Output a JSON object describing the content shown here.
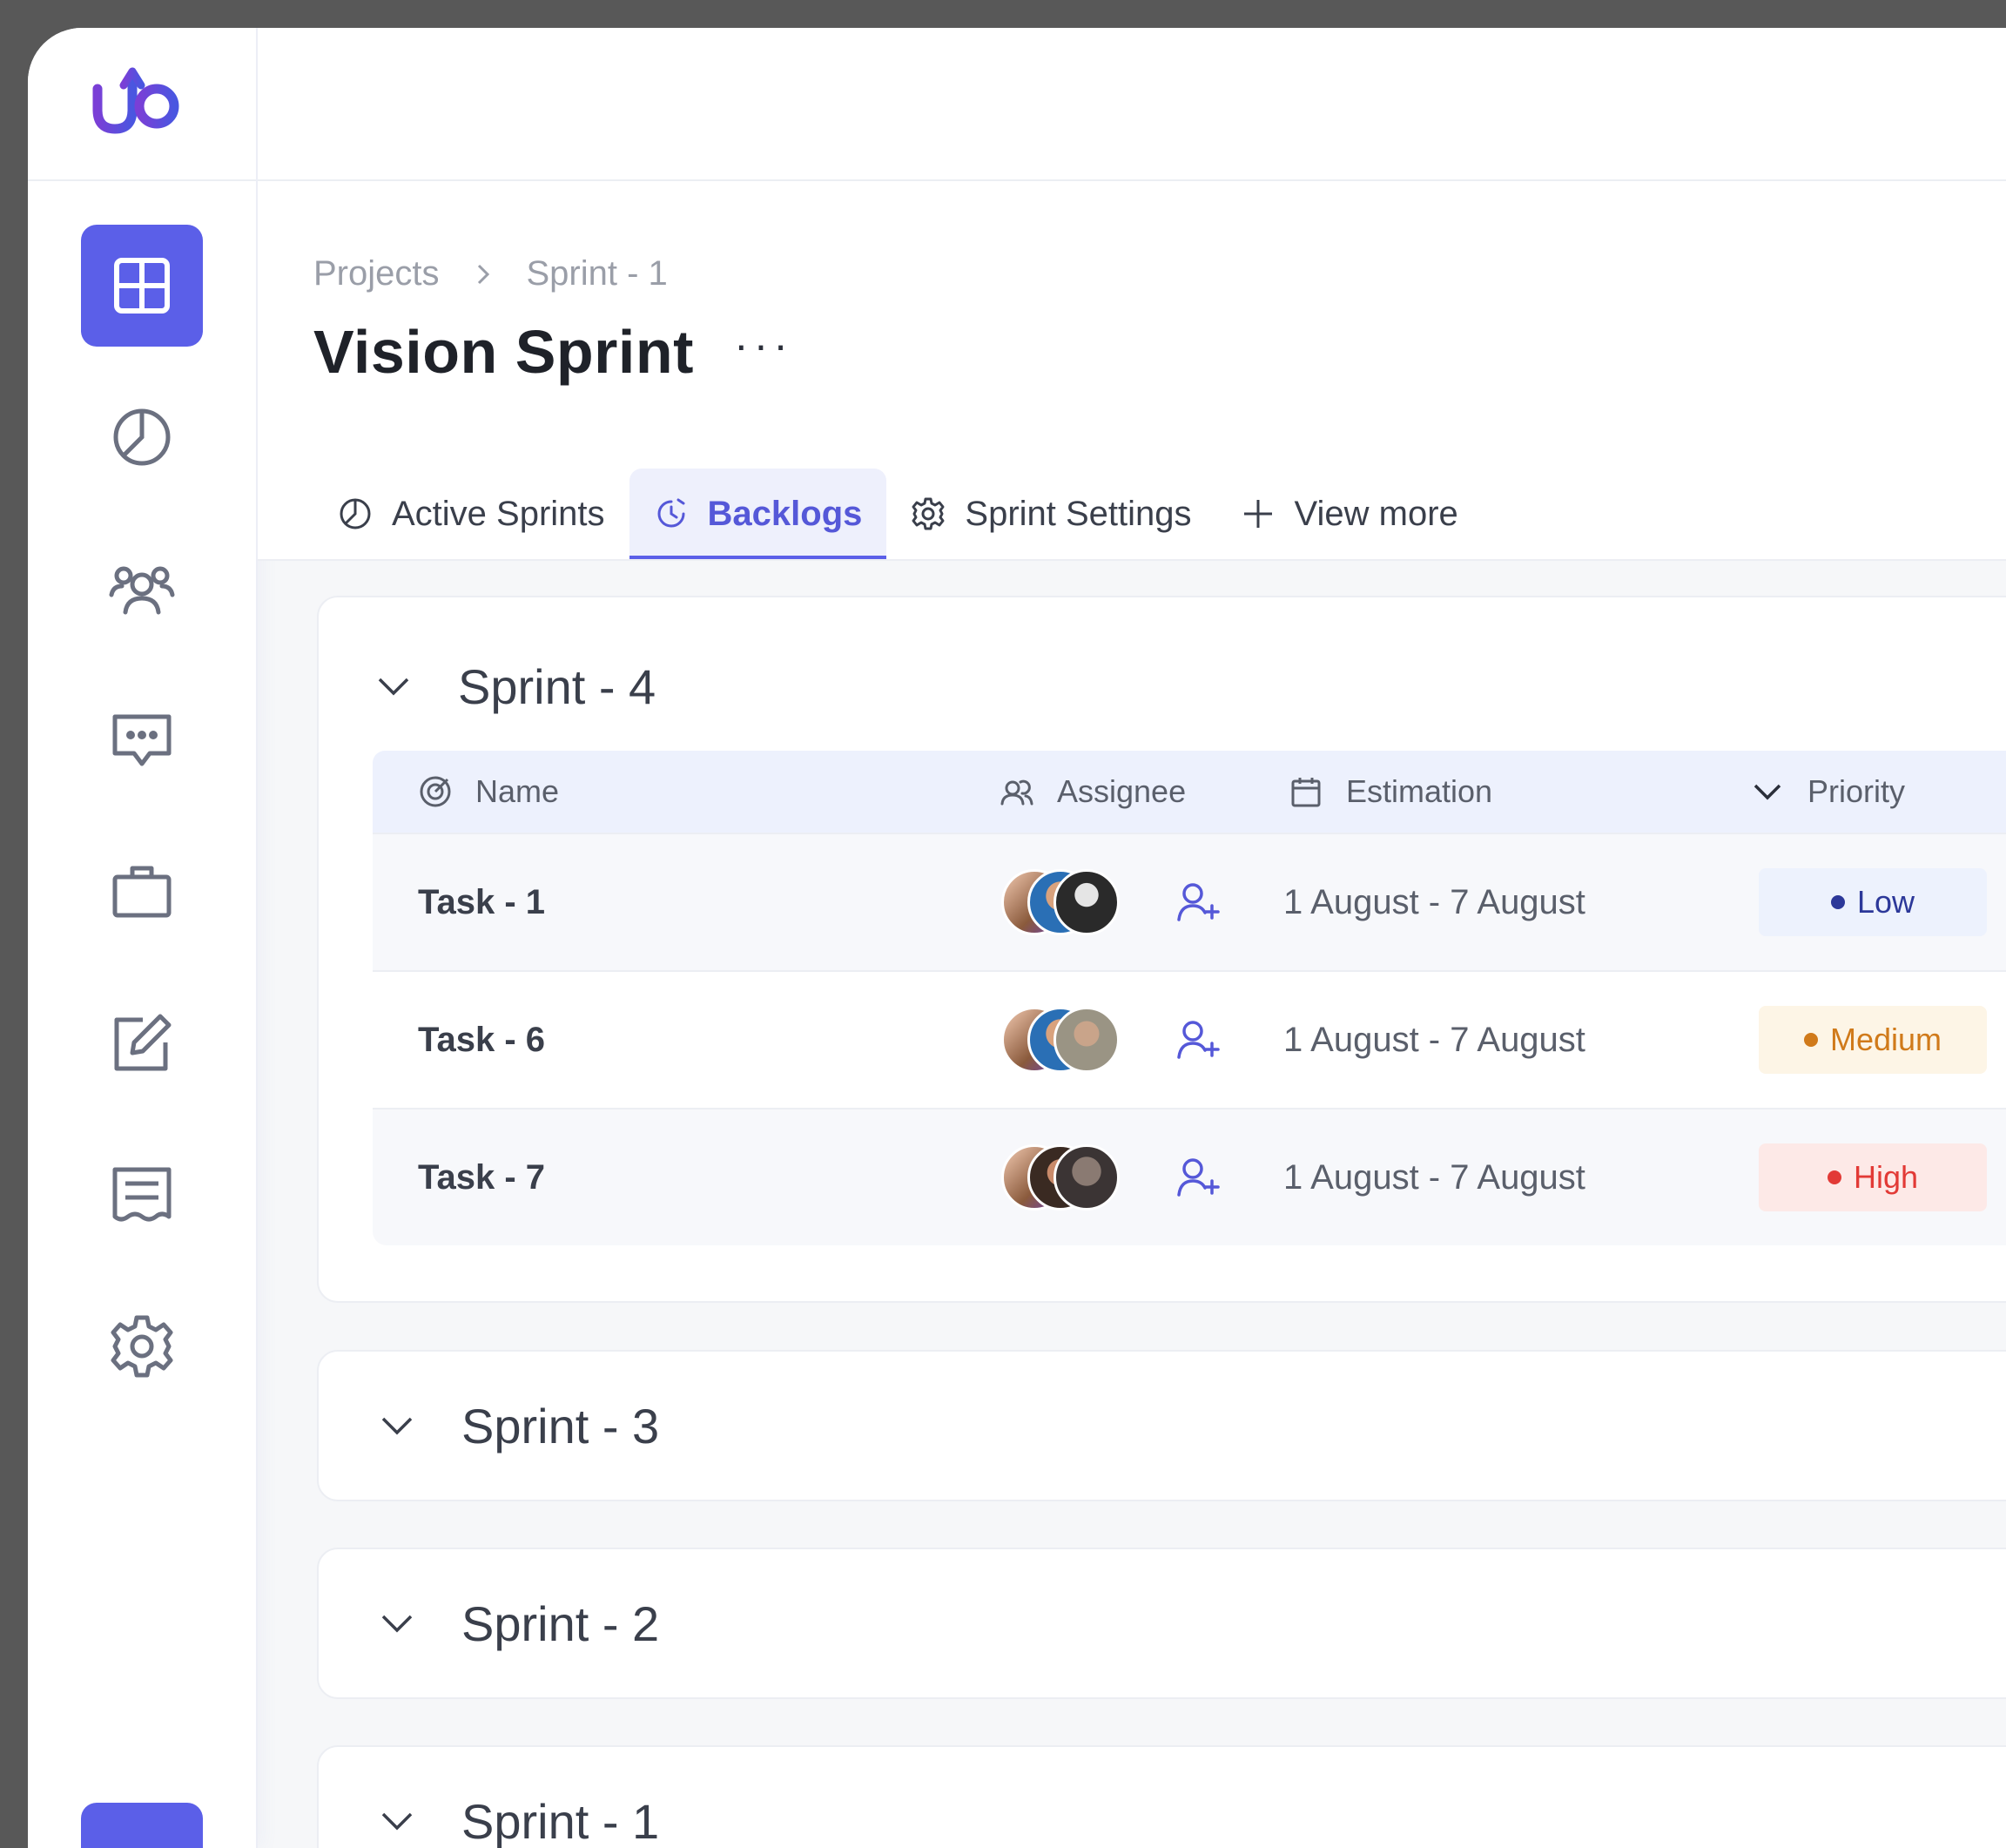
{
  "app": {
    "logo_text": "up"
  },
  "sidebar": {
    "items": [
      {
        "icon": "grid-icon",
        "active": true
      },
      {
        "icon": "pie-chart-icon"
      },
      {
        "icon": "users-icon"
      },
      {
        "icon": "chat-icon"
      },
      {
        "icon": "briefcase-icon"
      },
      {
        "icon": "edit-icon"
      },
      {
        "icon": "receipt-icon"
      },
      {
        "icon": "settings-icon"
      }
    ]
  },
  "breadcrumb": {
    "items": [
      "Projects",
      "Sprint - 1"
    ]
  },
  "page": {
    "title": "Vision Sprint",
    "more": "···"
  },
  "tabs": [
    {
      "label": "Active Sprints",
      "icon": "pie-chart-icon"
    },
    {
      "label": "Backlogs",
      "icon": "clock-icon",
      "active": true
    },
    {
      "label": "Sprint Settings",
      "icon": "gear-icon"
    },
    {
      "label": "View more",
      "icon": "plus-icon"
    }
  ],
  "sprints": [
    {
      "title": "Sprint - 4",
      "expanded": true,
      "columns": [
        "Name",
        "Assignee",
        "Estimation",
        "Priority"
      ],
      "tasks": [
        {
          "name": "Task -  1",
          "estimation": "1 August - 7 August",
          "priority": "Low"
        },
        {
          "name": "Task -  6",
          "estimation": "1 August - 7 August",
          "priority": "Medium"
        },
        {
          "name": "Task -  7",
          "estimation": "1 August - 7 August",
          "priority": "High"
        }
      ]
    },
    {
      "title": "Sprint - 3"
    },
    {
      "title": "Sprint - 2"
    },
    {
      "title": "Sprint - 1"
    }
  ],
  "colors": {
    "accent": "#5b5fe8",
    "low_bg": "#edf2fd",
    "low_fg": "#2c3899",
    "medium_bg": "#fdf5e6",
    "medium_fg": "#d07a1a",
    "high_bg": "#fde9e7",
    "high_fg": "#e23a36"
  }
}
